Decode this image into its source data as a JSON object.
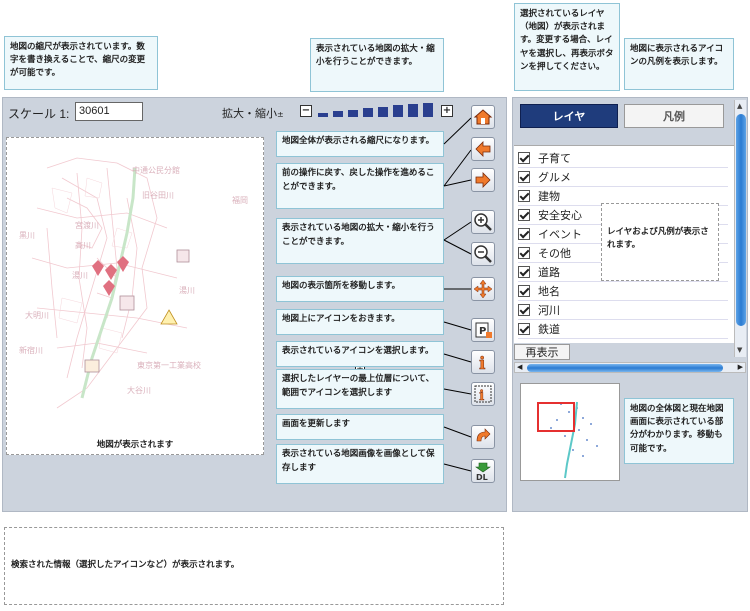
{
  "callouts": {
    "scale_note": "地図の縮尺が表示されています。数字を書き換えることで、縮尺の変更が可能です。",
    "zoom_note": "表示されている地図の拡大・縮小を行うことができます。",
    "layer_note": "選択されているレイヤ（地図）が表示されます。変更する場合、レイヤを選択し、再表示ボタンを押してください。",
    "legend_note": "地図に表示されるアイコンの凡例を表示します。",
    "layer_legend_note": "レイヤおよび凡例が表示されます。",
    "overview_note": "地図の全体図と現在地図画面に表示されている部分がわかります。移動も可能です。"
  },
  "toolbar": {
    "scale_label": "スケール 1:",
    "scale_value": "30601",
    "zoom_label": "拡大・縮小",
    "zoom_suffix": "±",
    "zoom_minus": "−",
    "zoom_plus": "+"
  },
  "map": {
    "caption": "地図が表示されます",
    "place_labels": [
      "中通公民分館",
      "旧谷田川",
      "福岡",
      "宮渡川",
      "黒川",
      "高川",
      "湯川",
      "湯川",
      "大明川",
      "東京第一工業高校",
      "新宿川",
      "大谷川"
    ]
  },
  "tools": [
    {
      "name": "home-tool",
      "desc": "地図全体が表示される縮尺になります。"
    },
    {
      "name": "back-tool",
      "desc": "前の操作に戻す、戻した操作を進めることができます。"
    },
    {
      "name": "forward-tool",
      "desc": ""
    },
    {
      "name": "zoom-in-tool",
      "desc": "表示されている地図の拡大・縮小を行うことができます。"
    },
    {
      "name": "zoom-out-tool",
      "desc": ""
    },
    {
      "name": "pan-tool",
      "desc": "地図の表示箇所を移動します。"
    },
    {
      "name": "place-icon-tool",
      "desc": "地図上にアイコンをおきます。"
    },
    {
      "name": "select-icon-tool",
      "desc": "表示されているアイコンを選択します。"
    },
    {
      "name": "select-range-tool",
      "desc": "選択したレイヤーの最上位層について、範囲でアイコンを選択します"
    },
    {
      "name": "refresh-tool",
      "desc": "画面を更新します"
    },
    {
      "name": "download-tool",
      "desc": "表示されている地図画像を画像として保存します"
    }
  ],
  "tool_icon_labels": {
    "place": "P",
    "info": "i",
    "download": "DL"
  },
  "tabs": {
    "layer": "レイヤ",
    "legend": "凡例"
  },
  "layers": [
    "子育て",
    "グルメ",
    "建物",
    "安全安心",
    "イベント",
    "その他",
    "道路",
    "地名",
    "河川",
    "鉄道"
  ],
  "redisplay_label": "再表示",
  "result_text": "検索された情報（選択したアイコンなど）が表示されます。",
  "colors": {
    "tab_active": "#1f3c7c",
    "zoom_bar": "#2a3f8f",
    "scroll": "#2a7bd2",
    "map_road": "#e8b0b8",
    "overview_rect": "#e53030"
  }
}
